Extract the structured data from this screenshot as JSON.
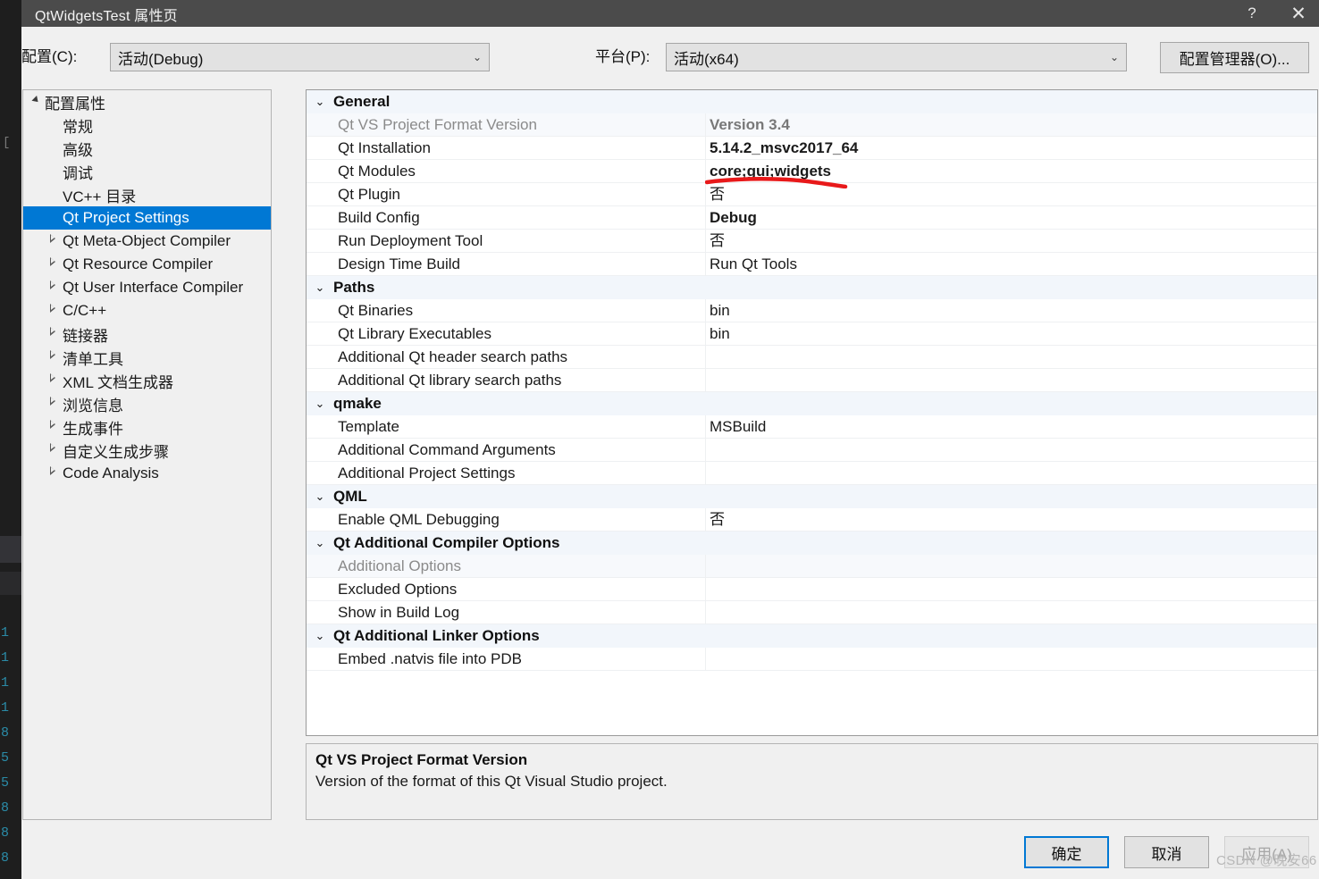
{
  "window": {
    "title": "QtWidgetsTest 属性页",
    "help_icon": "?",
    "close_icon": "✕"
  },
  "config_bar": {
    "config_label": "配置(C):",
    "config_value": "活动(Debug)",
    "platform_label": "平台(P):",
    "platform_value": "活动(x64)",
    "config_manager_button": "配置管理器(O)...",
    "dropdown_arrow": "⌄"
  },
  "tree": {
    "root": {
      "label": "配置属性",
      "expander": "expanded"
    },
    "items": [
      {
        "label": "常规",
        "expander": "none",
        "selected": false
      },
      {
        "label": "高级",
        "expander": "none",
        "selected": false
      },
      {
        "label": "调试",
        "expander": "none",
        "selected": false
      },
      {
        "label": "VC++ 目录",
        "expander": "none",
        "selected": false
      },
      {
        "label": "Qt Project Settings",
        "expander": "none",
        "selected": true
      },
      {
        "label": "Qt Meta-Object Compiler",
        "expander": "collapsed",
        "selected": false
      },
      {
        "label": "Qt Resource Compiler",
        "expander": "collapsed",
        "selected": false
      },
      {
        "label": "Qt User Interface Compiler",
        "expander": "collapsed",
        "selected": false
      },
      {
        "label": "C/C++",
        "expander": "collapsed",
        "selected": false
      },
      {
        "label": "链接器",
        "expander": "collapsed",
        "selected": false
      },
      {
        "label": "清单工具",
        "expander": "collapsed",
        "selected": false
      },
      {
        "label": "XML 文档生成器",
        "expander": "collapsed",
        "selected": false
      },
      {
        "label": "浏览信息",
        "expander": "collapsed",
        "selected": false
      },
      {
        "label": "生成事件",
        "expander": "collapsed",
        "selected": false
      },
      {
        "label": "自定义生成步骤",
        "expander": "collapsed",
        "selected": false
      },
      {
        "label": "Code Analysis",
        "expander": "collapsed",
        "selected": false
      }
    ]
  },
  "grid": {
    "chevron": "⌄",
    "sections": [
      {
        "title": "General",
        "rows": [
          {
            "name": "Qt VS Project Format Version",
            "value": "Version 3.4",
            "readonly": true,
            "bold_value": true
          },
          {
            "name": "Qt Installation",
            "value": "5.14.2_msvc2017_64",
            "readonly": false,
            "bold_value": true
          },
          {
            "name": "Qt Modules",
            "value": "core;gui;widgets",
            "readonly": false,
            "bold_value": true,
            "annotated": true
          },
          {
            "name": "Qt Plugin",
            "value": "否",
            "readonly": false,
            "bold_value": false
          },
          {
            "name": "Build Config",
            "value": "Debug",
            "readonly": false,
            "bold_value": true
          },
          {
            "name": "Run Deployment Tool",
            "value": "否",
            "readonly": false,
            "bold_value": false
          },
          {
            "name": "Design Time Build",
            "value": "Run Qt Tools",
            "readonly": false,
            "bold_value": false
          }
        ]
      },
      {
        "title": "Paths",
        "rows": [
          {
            "name": "Qt Binaries",
            "value": "bin",
            "readonly": false,
            "bold_value": false
          },
          {
            "name": "Qt Library Executables",
            "value": "bin",
            "readonly": false,
            "bold_value": false
          },
          {
            "name": "Additional Qt header search paths",
            "value": "",
            "readonly": false,
            "bold_value": false
          },
          {
            "name": "Additional Qt library search paths",
            "value": "",
            "readonly": false,
            "bold_value": false
          }
        ]
      },
      {
        "title": "qmake",
        "rows": [
          {
            "name": "Template",
            "value": "MSBuild",
            "readonly": false,
            "bold_value": false
          },
          {
            "name": "Additional Command Arguments",
            "value": "",
            "readonly": false,
            "bold_value": false
          },
          {
            "name": "Additional Project Settings",
            "value": "",
            "readonly": false,
            "bold_value": false
          }
        ]
      },
      {
        "title": "QML",
        "rows": [
          {
            "name": "Enable QML Debugging",
            "value": "否",
            "readonly": false,
            "bold_value": false
          }
        ]
      },
      {
        "title": "Qt Additional Compiler Options",
        "rows": [
          {
            "name": "Additional Options",
            "value": "",
            "readonly": true,
            "bold_value": false
          },
          {
            "name": "Excluded Options",
            "value": "",
            "readonly": false,
            "bold_value": false
          },
          {
            "name": "Show in Build Log",
            "value": "",
            "readonly": false,
            "bold_value": false
          }
        ]
      },
      {
        "title": "Qt Additional Linker Options",
        "rows": [
          {
            "name": "Embed .natvis file into PDB",
            "value": "",
            "readonly": false,
            "bold_value": false
          }
        ]
      }
    ]
  },
  "description": {
    "title": "Qt VS Project Format Version",
    "body": "Version of the format of this Qt Visual Studio project."
  },
  "buttons": {
    "ok": "确定",
    "cancel": "取消",
    "apply": "应用(A)"
  },
  "watermark": "CSDN @晚安66",
  "backdrop": {
    "gutter_numbers": [
      "1",
      "1",
      "1",
      "1",
      "8",
      "5",
      "5",
      "8",
      "8",
      "8"
    ]
  },
  "colors": {
    "titlebar": "#4b4b4b",
    "dialog_bg": "#f0f0f0",
    "selection": "#0078d4",
    "section_bg": "#f2f6fb",
    "annotation_red": "#e8191a",
    "grid_bg": "#ffffff"
  }
}
